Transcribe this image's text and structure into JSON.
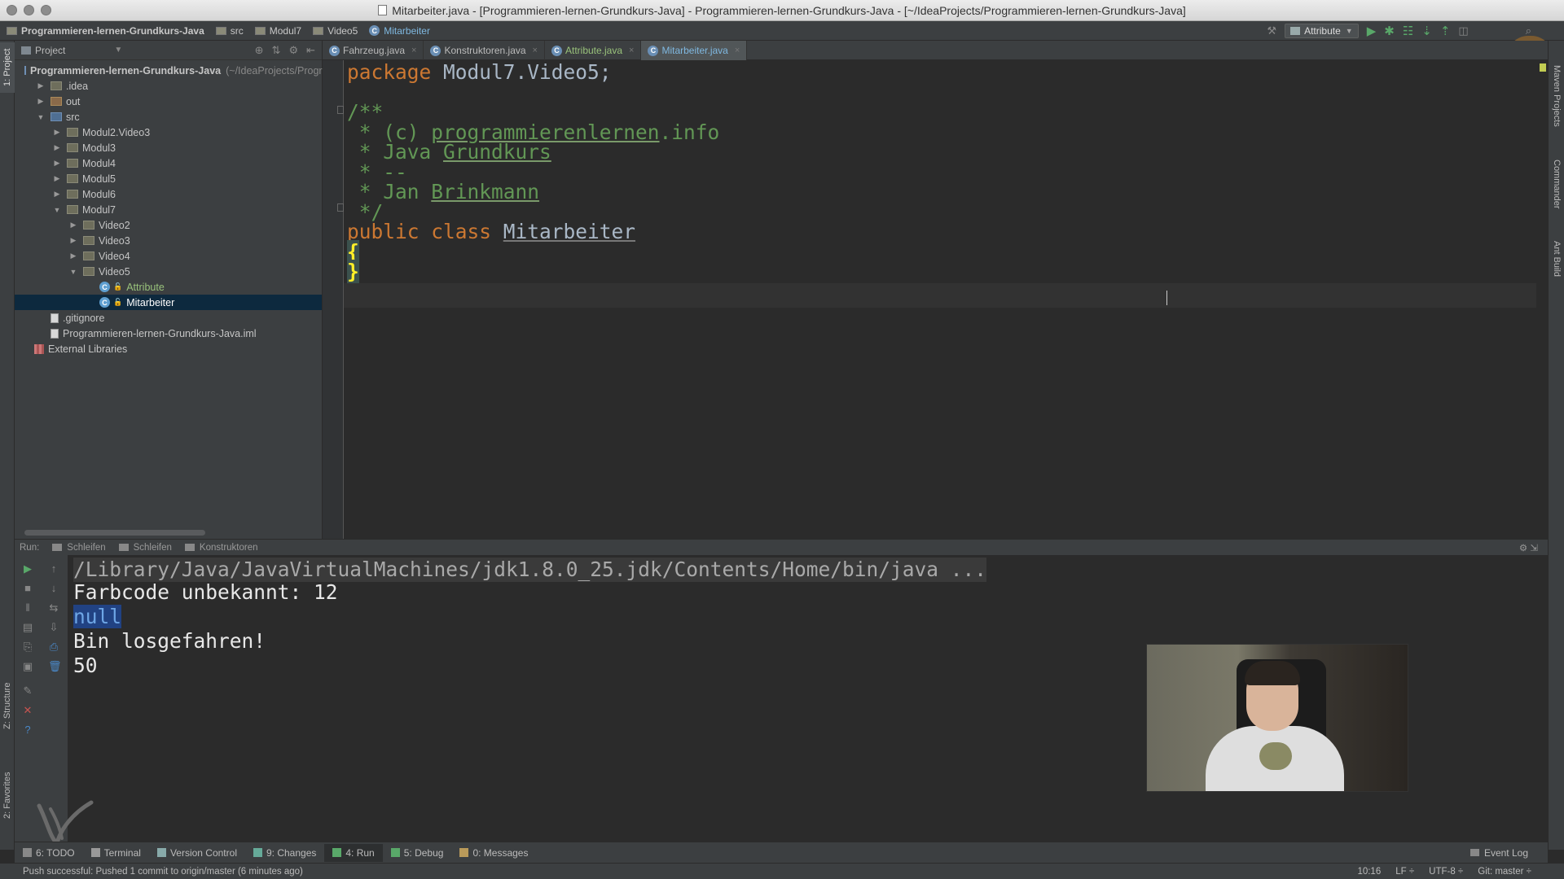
{
  "window": {
    "title": "Mitarbeiter.java - [Programmieren-lernen-Grundkurs-Java] - Programmieren-lernen-Grundkurs-Java - [~/IdeaProjects/Programmieren-lernen-Grundkurs-Java]"
  },
  "breadcrumbs": [
    "Programmieren-lernen-Grundkurs-Java",
    "src",
    "Modul7",
    "Video5",
    "Mitarbeiter"
  ],
  "toolbar": {
    "run_config": "Attribute",
    "icons": [
      "run-icon",
      "debug-icon",
      "coverage-icon",
      "vcs-update-icon",
      "vcs-commit-icon",
      "sdk-icon",
      "search-icon"
    ]
  },
  "left_strip": {
    "project_tab": "1: Project",
    "structure_tab": "Z: Structure",
    "favorites_tab": "2: Favorites"
  },
  "right_strip": {
    "maven_tab": "Maven Projects",
    "commander_tab": "Commander",
    "ant_tab": "Ant Build"
  },
  "project_panel": {
    "title": "Project",
    "tree": [
      {
        "label": "Programmieren-lernen-Grundkurs-Java",
        "hint": "(~/IdeaProjects/Programmieren-lernen-Grundkurs-Java)",
        "depth": 0,
        "arrow": "",
        "icon": "module"
      },
      {
        "label": ".idea",
        "depth": 1,
        "arrow": "▶",
        "icon": "folder"
      },
      {
        "label": "out",
        "depth": 1,
        "arrow": "▶",
        "icon": "folder-excluded"
      },
      {
        "label": "src",
        "depth": 1,
        "arrow": "▼",
        "icon": "folder-source"
      },
      {
        "label": "Modul2.Video3",
        "depth": 2,
        "arrow": "▶",
        "icon": "package"
      },
      {
        "label": "Modul3",
        "depth": 2,
        "arrow": "▶",
        "icon": "package"
      },
      {
        "label": "Modul4",
        "depth": 2,
        "arrow": "▶",
        "icon": "package"
      },
      {
        "label": "Modul5",
        "depth": 2,
        "arrow": "▶",
        "icon": "package"
      },
      {
        "label": "Modul6",
        "depth": 2,
        "arrow": "▶",
        "icon": "package"
      },
      {
        "label": "Modul7",
        "depth": 2,
        "arrow": "▼",
        "icon": "package"
      },
      {
        "label": "Video2",
        "depth": 3,
        "arrow": "▶",
        "icon": "package"
      },
      {
        "label": "Video3",
        "depth": 3,
        "arrow": "▶",
        "icon": "package"
      },
      {
        "label": "Video4",
        "depth": 3,
        "arrow": "▶",
        "icon": "package"
      },
      {
        "label": "Video5",
        "depth": 3,
        "arrow": "▼",
        "icon": "package"
      },
      {
        "label": "Attribute",
        "depth": 4,
        "arrow": "",
        "icon": "class",
        "modified": true
      },
      {
        "label": "Mitarbeiter",
        "depth": 4,
        "arrow": "",
        "icon": "class",
        "selected": true
      },
      {
        "label": ".gitignore",
        "depth": 1,
        "arrow": "",
        "icon": "file"
      },
      {
        "label": "Programmieren-lernen-Grundkurs-Java.iml",
        "depth": 1,
        "arrow": "",
        "icon": "iml"
      },
      {
        "label": "External Libraries",
        "depth": 0,
        "arrow": "",
        "icon": "library"
      }
    ]
  },
  "editor_tabs": [
    {
      "label": "Fahrzeug.java",
      "active": false,
      "modified": false
    },
    {
      "label": "Konstruktoren.java",
      "active": false,
      "modified": false
    },
    {
      "label": "Attribute.java",
      "active": false,
      "modified": true
    },
    {
      "label": "Mitarbeiter.java",
      "active": true,
      "modified": false
    }
  ],
  "editor": {
    "lines": {
      "l1_kw": "package ",
      "l1_rest": "Modul7.Video5;",
      "l3": "/**",
      "l4_a": " * (c) ",
      "l4_b": "programmierenlernen",
      "l4_c": ".info",
      "l5_a": " * Java ",
      "l5_b": "Grundkurs",
      "l6": " * --",
      "l7_a": " * Jan ",
      "l7_b": "Brinkmann",
      "l8": " */",
      "l9_kw": "public class ",
      "l9_name": "Mitarbeiter",
      "l10": "{",
      "l11": "}"
    }
  },
  "run_panel": {
    "label": "Run:",
    "tabs": [
      "Schleifen",
      "Schleifen",
      "Konstruktoren"
    ],
    "output": [
      "/Library/Java/JavaVirtualMachines/jdk1.8.0_25.jdk/Contents/Home/bin/java ...",
      "Farbcode unbekannt: 12",
      "null",
      "Bin losgefahren!",
      "50"
    ]
  },
  "bottom_tools": [
    {
      "num": "6",
      "label": "6: TODO"
    },
    {
      "num": "",
      "label": "Terminal"
    },
    {
      "num": "",
      "label": "Version Control"
    },
    {
      "num": "9",
      "label": "9: Changes"
    },
    {
      "num": "4",
      "label": "4: Run",
      "active": true
    },
    {
      "num": "5",
      "label": "5: Debug"
    },
    {
      "num": "0",
      "label": "0: Messages"
    }
  ],
  "event_log": "Event Log",
  "status": {
    "message": "Push successful: Pushed 1 commit to origin/master (6 minutes ago)",
    "position": "10:16",
    "line_sep": "LF ÷",
    "encoding": "UTF-8 ÷",
    "git": "Git: master ÷"
  },
  "colors": {
    "keyword": "#cc7832",
    "comment": "#629755",
    "brace_match": "#ffef28",
    "selection": "#0d293e"
  }
}
